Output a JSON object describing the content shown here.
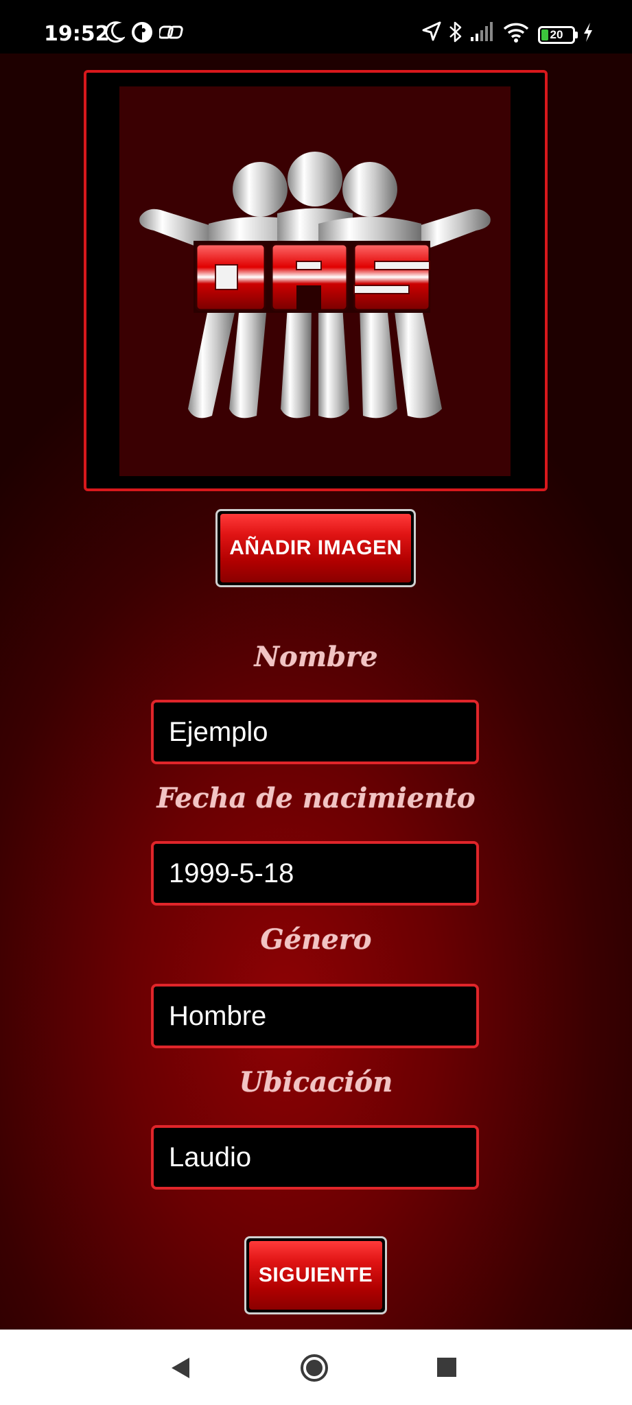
{
  "status_bar": {
    "time": "19:52",
    "battery": "20",
    "icons": [
      "moon-icon",
      "data-saver-icon",
      "link-icon",
      "location-icon",
      "bluetooth-icon",
      "signal-icon",
      "wifi-icon",
      "battery-icon",
      "charging-icon"
    ]
  },
  "logo": {
    "text": "DAS"
  },
  "add_image_button": {
    "label": "AÑADIR IMAGEN"
  },
  "form": {
    "fields": [
      {
        "label": "Nombre",
        "value": "Ejemplo"
      },
      {
        "label": "Fecha de nacimiento",
        "value": "1999-5-18"
      },
      {
        "label": "Género",
        "value": "Hombre"
      },
      {
        "label": "Ubicación",
        "value": "Laudio"
      }
    ]
  },
  "next_button": {
    "label": "SIGUIENTE"
  },
  "nav": {
    "icons": [
      "back-icon",
      "home-icon",
      "recents-icon"
    ]
  },
  "colors": {
    "accent": "#e0252a",
    "background": "#6a0002",
    "label": "#f2c4c4"
  }
}
